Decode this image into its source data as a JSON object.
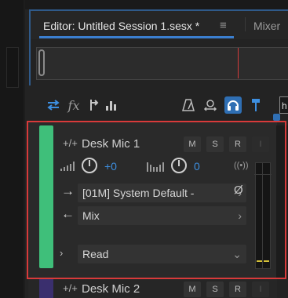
{
  "editor": {
    "tab_title": "Editor: Untitled Session 1.sesx *",
    "menu_glyph": "≡",
    "mixer_tab": "Mixer"
  },
  "toolbar": {
    "icons": [
      "swap-arrows-icon",
      "fx-icon",
      "send-icon",
      "eq-icon",
      "metronome-icon",
      "punch-icon",
      "headphone-icon",
      "pin-icon"
    ],
    "fx_label": "fx",
    "timecode_partial": "h"
  },
  "track1": {
    "name": "Desk Mic 1",
    "mute": "M",
    "solo": "S",
    "record": "R",
    "input_monitor": "I",
    "volume": "+0",
    "pan": "0",
    "input": "[01M] System Default -",
    "output": "Mix",
    "automation_mode": "Read",
    "stereo_glyph": "((•))",
    "phase_glyph": "Ø",
    "accent_color": "#3fbf7a"
  },
  "track2": {
    "name": "Desk Mic 2",
    "mute": "M",
    "solo": "S",
    "record": "R",
    "input_monitor": "I"
  },
  "colors": {
    "accent_blue": "#3d8fe0",
    "highlight_red": "#d83a3a",
    "playhead_red": "#d43c3c"
  }
}
